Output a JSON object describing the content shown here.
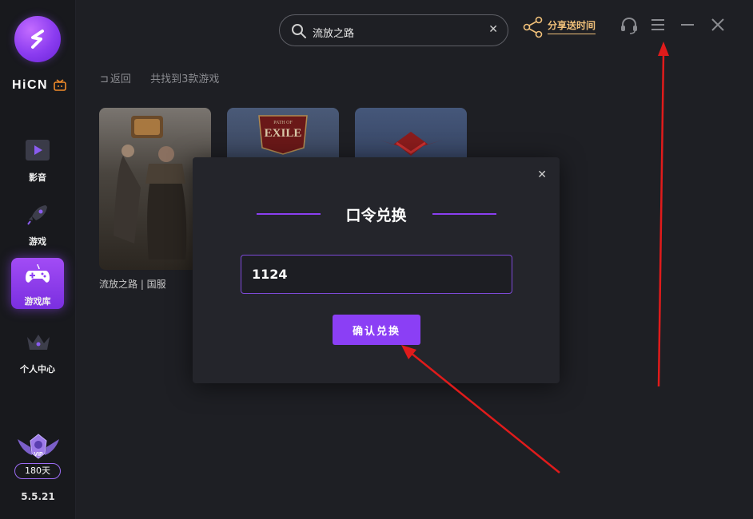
{
  "app": {
    "brand": "HiCN",
    "version": "5.5.21",
    "accent": "#8b3ff5"
  },
  "sidebar": {
    "items": [
      {
        "label": "影音",
        "icon": "play-icon",
        "active": false
      },
      {
        "label": "游戏",
        "icon": "rocket-icon",
        "active": false
      },
      {
        "label": "游戏库",
        "icon": "gamepad-icon",
        "active": true
      },
      {
        "label": "个人中心",
        "icon": "crown-icon",
        "active": false
      }
    ],
    "vip": {
      "badge": "VIP",
      "days": "180天"
    }
  },
  "topbar": {
    "search_value": "流放之路",
    "share_label": "分享送时间"
  },
  "breadcrumb": {
    "back": "返回",
    "result": "共找到3款游戏"
  },
  "games": [
    {
      "title": "流放之路 | 国服"
    }
  ],
  "modal": {
    "title": "口令兑换",
    "code_value": "1124",
    "confirm_label": "确认兑换"
  }
}
